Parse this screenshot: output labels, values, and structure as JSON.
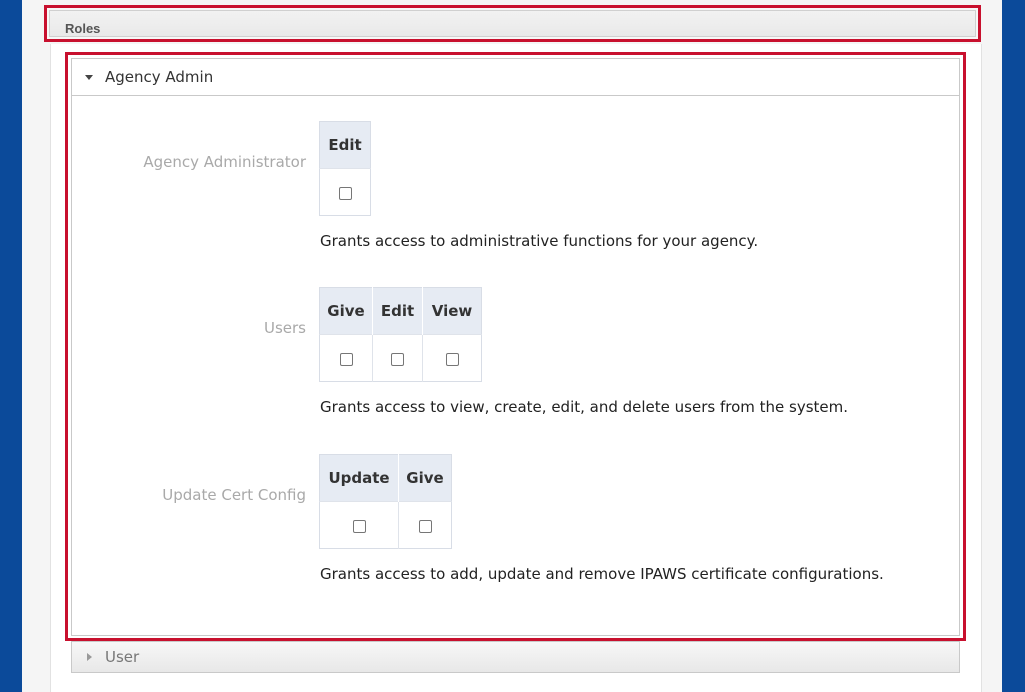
{
  "roles": {
    "title": "Roles"
  },
  "agency_admin": {
    "title": "Agency Admin",
    "permissions": [
      {
        "label": "Agency Administrator",
        "columns": [
          "Edit"
        ],
        "description": "Grants access to administrative functions for your agency."
      },
      {
        "label": "Users",
        "columns": [
          "Give",
          "Edit",
          "View"
        ],
        "description": "Grants access to view, create, edit, and delete users from the system."
      },
      {
        "label": "Update Cert Config",
        "columns": [
          "Update",
          "Give"
        ],
        "description": "Grants access to add, update and remove IPAWS certificate configurations."
      }
    ]
  },
  "user_section": {
    "title": "User"
  },
  "colors": {
    "highlight": "#c8102e",
    "page_bg": "#0b4a9a",
    "header_cell": "#e6ebf3"
  }
}
